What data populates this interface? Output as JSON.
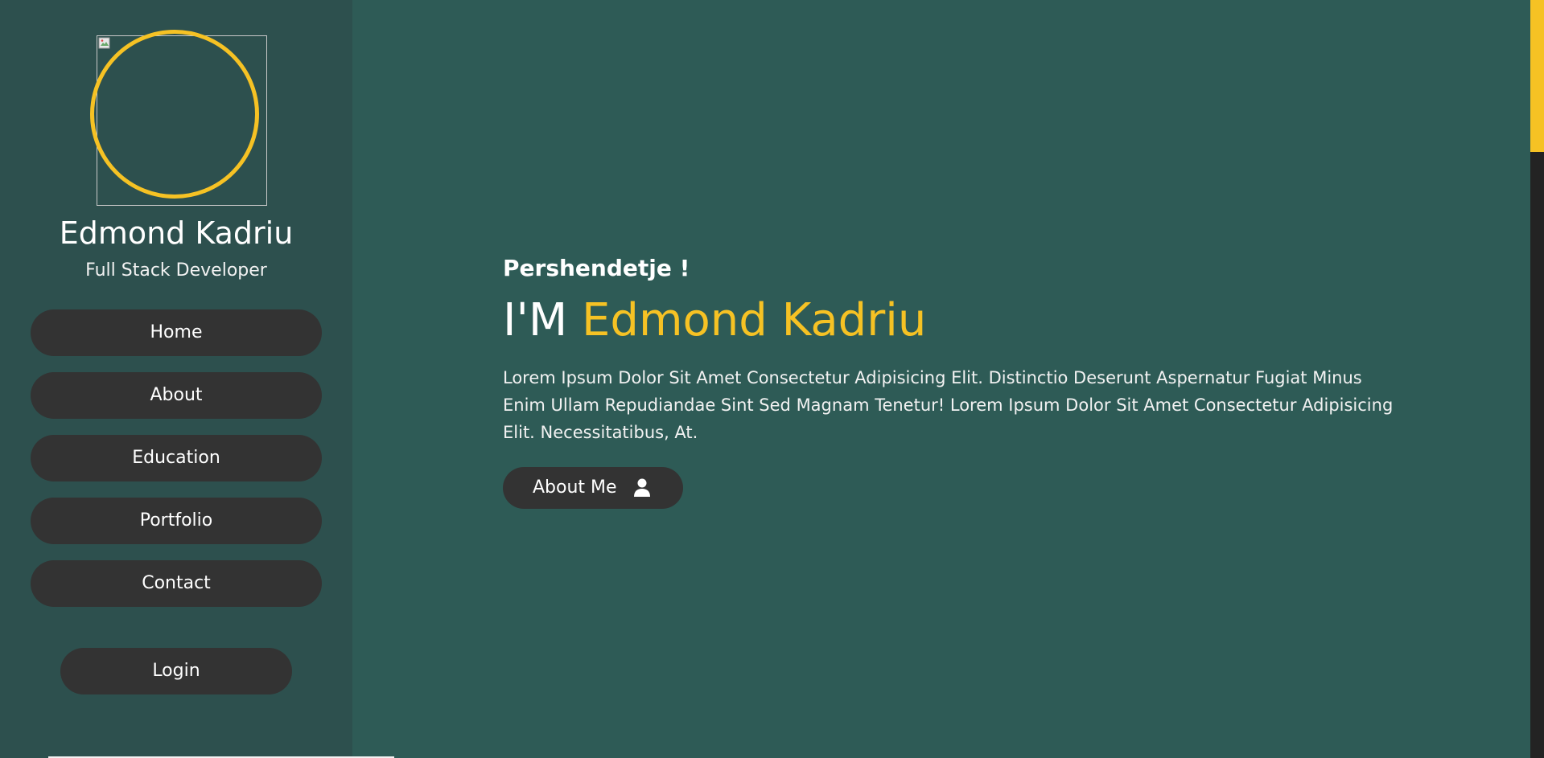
{
  "sidebar": {
    "name": "Edmond Kadriu",
    "role": "Full Stack Developer",
    "nav": [
      "Home",
      "About",
      "Education",
      "Portfolio",
      "Contact"
    ],
    "login_label": "Login"
  },
  "hero": {
    "greeting": "Pershendetje !",
    "title_prefix": "I'M",
    "title_name": "Edmond Kadriu",
    "description": "Lorem Ipsum Dolor Sit Amet Consectetur Adipisicing Elit. Distinctio Deserunt Aspernatur Fugiat Minus Enim Ullam Repudiandae Sint Sed Magnam Tenetur! Lorem Ipsum Dolor Sit Amet Consectetur Adipisicing Elit. Necessitatibus, At.",
    "about_button_label": "About Me",
    "about_button_icon": "user-icon"
  },
  "icons": {
    "profile_placeholder": "broken-image-icon"
  },
  "colors": {
    "background": "#2e5b56",
    "sidebar": "#2d504e",
    "accent": "#f6c224",
    "button": "#333333",
    "text": "#ffffff"
  }
}
